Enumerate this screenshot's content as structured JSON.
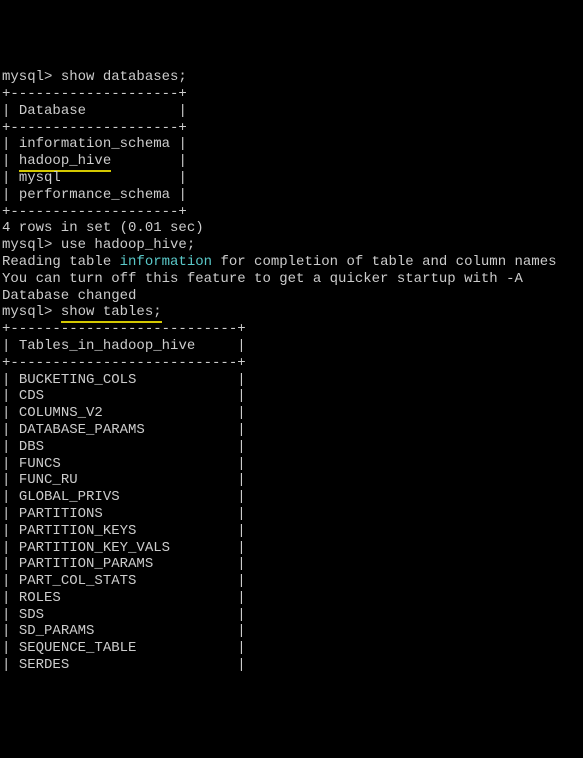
{
  "prompt1": "mysql> ",
  "cmd1": "show databases;",
  "border1_top": "+--------------------+",
  "header1_left": "| ",
  "header1_text": "Database",
  "header1_right": "           |",
  "border1_mid": "+--------------------+",
  "db_rows": [
    {
      "left": "| ",
      "name": "information_schema",
      "right": " |",
      "hl": false
    },
    {
      "left": "| ",
      "name": "hadoop_hive",
      "right": "        |",
      "hl": true
    },
    {
      "left": "| ",
      "name": "mysql",
      "right": "              |",
      "hl": false
    },
    {
      "left": "| ",
      "name": "performance_schema",
      "right": " |",
      "hl": false
    }
  ],
  "border1_bot": "+--------------------+",
  "result1": "4 rows in set (0.01 sec)",
  "blank": "",
  "prompt2": "mysql> ",
  "cmd2": "use hadoop_hive;",
  "reading_pre": "Reading table ",
  "reading_cyan": "information",
  "reading_post": " for completion of table and column names",
  "turnoff": "You can turn off this feature to get a quicker startup with -A",
  "dbchanged": "Database changed",
  "prompt3": "mysql> ",
  "cmd3": "show tables;",
  "border2_top": "+---------------------------+",
  "header2_left": "| ",
  "header2_text": "Tables_in_hadoop_hive",
  "header2_right": "     |",
  "border2_mid": "+---------------------------+",
  "table_rows": [
    {
      "left": "| ",
      "name": "BUCKETING_COLS",
      "right": "            |"
    },
    {
      "left": "| ",
      "name": "CDS",
      "right": "                       |"
    },
    {
      "left": "| ",
      "name": "COLUMNS_V2",
      "right": "                |"
    },
    {
      "left": "| ",
      "name": "DATABASE_PARAMS",
      "right": "           |"
    },
    {
      "left": "| ",
      "name": "DBS",
      "right": "                       |"
    },
    {
      "left": "| ",
      "name": "FUNCS",
      "right": "                     |"
    },
    {
      "left": "| ",
      "name": "FUNC_RU",
      "right": "                   |"
    },
    {
      "left": "| ",
      "name": "GLOBAL_PRIVS",
      "right": "              |"
    },
    {
      "left": "| ",
      "name": "PARTITIONS",
      "right": "                |"
    },
    {
      "left": "| ",
      "name": "PARTITION_KEYS",
      "right": "            |"
    },
    {
      "left": "| ",
      "name": "PARTITION_KEY_VALS",
      "right": "        |"
    },
    {
      "left": "| ",
      "name": "PARTITION_PARAMS",
      "right": "          |"
    },
    {
      "left": "| ",
      "name": "PART_COL_STATS",
      "right": "            |"
    },
    {
      "left": "| ",
      "name": "ROLES",
      "right": "                     |"
    },
    {
      "left": "| ",
      "name": "SDS",
      "right": "                       |"
    },
    {
      "left": "| ",
      "name": "SD_PARAMS",
      "right": "                 |"
    },
    {
      "left": "| ",
      "name": "SEQUENCE_TABLE",
      "right": "            |"
    },
    {
      "left": "| ",
      "name": "SERDES",
      "right": "                    |"
    }
  ]
}
